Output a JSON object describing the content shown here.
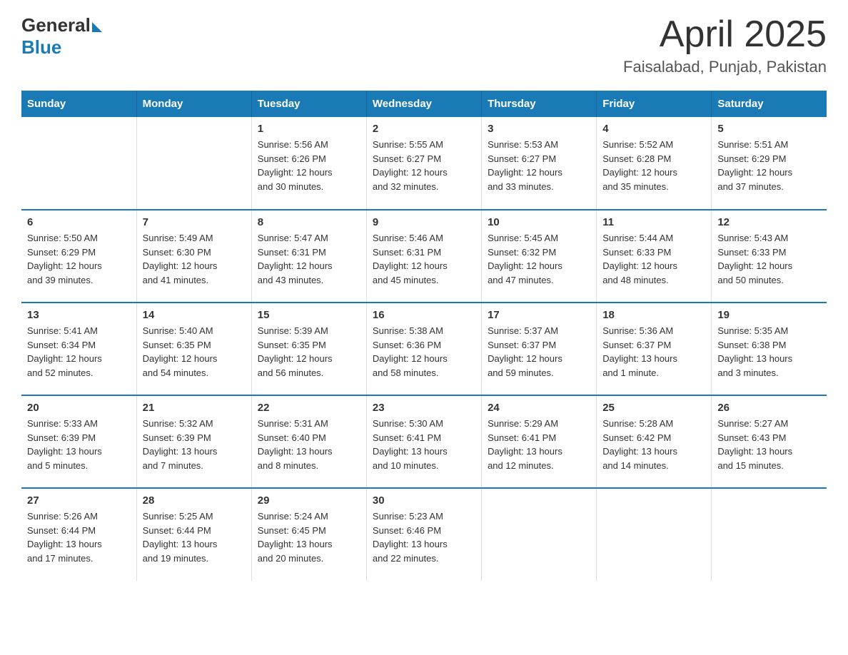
{
  "logo": {
    "general": "General",
    "blue": "Blue"
  },
  "title": "April 2025",
  "subtitle": "Faisalabad, Punjab, Pakistan",
  "days_of_week": [
    "Sunday",
    "Monday",
    "Tuesday",
    "Wednesday",
    "Thursday",
    "Friday",
    "Saturday"
  ],
  "weeks": [
    [
      {
        "day": "",
        "info": ""
      },
      {
        "day": "",
        "info": ""
      },
      {
        "day": "1",
        "info": "Sunrise: 5:56 AM\nSunset: 6:26 PM\nDaylight: 12 hours\nand 30 minutes."
      },
      {
        "day": "2",
        "info": "Sunrise: 5:55 AM\nSunset: 6:27 PM\nDaylight: 12 hours\nand 32 minutes."
      },
      {
        "day": "3",
        "info": "Sunrise: 5:53 AM\nSunset: 6:27 PM\nDaylight: 12 hours\nand 33 minutes."
      },
      {
        "day": "4",
        "info": "Sunrise: 5:52 AM\nSunset: 6:28 PM\nDaylight: 12 hours\nand 35 minutes."
      },
      {
        "day": "5",
        "info": "Sunrise: 5:51 AM\nSunset: 6:29 PM\nDaylight: 12 hours\nand 37 minutes."
      }
    ],
    [
      {
        "day": "6",
        "info": "Sunrise: 5:50 AM\nSunset: 6:29 PM\nDaylight: 12 hours\nand 39 minutes."
      },
      {
        "day": "7",
        "info": "Sunrise: 5:49 AM\nSunset: 6:30 PM\nDaylight: 12 hours\nand 41 minutes."
      },
      {
        "day": "8",
        "info": "Sunrise: 5:47 AM\nSunset: 6:31 PM\nDaylight: 12 hours\nand 43 minutes."
      },
      {
        "day": "9",
        "info": "Sunrise: 5:46 AM\nSunset: 6:31 PM\nDaylight: 12 hours\nand 45 minutes."
      },
      {
        "day": "10",
        "info": "Sunrise: 5:45 AM\nSunset: 6:32 PM\nDaylight: 12 hours\nand 47 minutes."
      },
      {
        "day": "11",
        "info": "Sunrise: 5:44 AM\nSunset: 6:33 PM\nDaylight: 12 hours\nand 48 minutes."
      },
      {
        "day": "12",
        "info": "Sunrise: 5:43 AM\nSunset: 6:33 PM\nDaylight: 12 hours\nand 50 minutes."
      }
    ],
    [
      {
        "day": "13",
        "info": "Sunrise: 5:41 AM\nSunset: 6:34 PM\nDaylight: 12 hours\nand 52 minutes."
      },
      {
        "day": "14",
        "info": "Sunrise: 5:40 AM\nSunset: 6:35 PM\nDaylight: 12 hours\nand 54 minutes."
      },
      {
        "day": "15",
        "info": "Sunrise: 5:39 AM\nSunset: 6:35 PM\nDaylight: 12 hours\nand 56 minutes."
      },
      {
        "day": "16",
        "info": "Sunrise: 5:38 AM\nSunset: 6:36 PM\nDaylight: 12 hours\nand 58 minutes."
      },
      {
        "day": "17",
        "info": "Sunrise: 5:37 AM\nSunset: 6:37 PM\nDaylight: 12 hours\nand 59 minutes."
      },
      {
        "day": "18",
        "info": "Sunrise: 5:36 AM\nSunset: 6:37 PM\nDaylight: 13 hours\nand 1 minute."
      },
      {
        "day": "19",
        "info": "Sunrise: 5:35 AM\nSunset: 6:38 PM\nDaylight: 13 hours\nand 3 minutes."
      }
    ],
    [
      {
        "day": "20",
        "info": "Sunrise: 5:33 AM\nSunset: 6:39 PM\nDaylight: 13 hours\nand 5 minutes."
      },
      {
        "day": "21",
        "info": "Sunrise: 5:32 AM\nSunset: 6:39 PM\nDaylight: 13 hours\nand 7 minutes."
      },
      {
        "day": "22",
        "info": "Sunrise: 5:31 AM\nSunset: 6:40 PM\nDaylight: 13 hours\nand 8 minutes."
      },
      {
        "day": "23",
        "info": "Sunrise: 5:30 AM\nSunset: 6:41 PM\nDaylight: 13 hours\nand 10 minutes."
      },
      {
        "day": "24",
        "info": "Sunrise: 5:29 AM\nSunset: 6:41 PM\nDaylight: 13 hours\nand 12 minutes."
      },
      {
        "day": "25",
        "info": "Sunrise: 5:28 AM\nSunset: 6:42 PM\nDaylight: 13 hours\nand 14 minutes."
      },
      {
        "day": "26",
        "info": "Sunrise: 5:27 AM\nSunset: 6:43 PM\nDaylight: 13 hours\nand 15 minutes."
      }
    ],
    [
      {
        "day": "27",
        "info": "Sunrise: 5:26 AM\nSunset: 6:44 PM\nDaylight: 13 hours\nand 17 minutes."
      },
      {
        "day": "28",
        "info": "Sunrise: 5:25 AM\nSunset: 6:44 PM\nDaylight: 13 hours\nand 19 minutes."
      },
      {
        "day": "29",
        "info": "Sunrise: 5:24 AM\nSunset: 6:45 PM\nDaylight: 13 hours\nand 20 minutes."
      },
      {
        "day": "30",
        "info": "Sunrise: 5:23 AM\nSunset: 6:46 PM\nDaylight: 13 hours\nand 22 minutes."
      },
      {
        "day": "",
        "info": ""
      },
      {
        "day": "",
        "info": ""
      },
      {
        "day": "",
        "info": ""
      }
    ]
  ]
}
